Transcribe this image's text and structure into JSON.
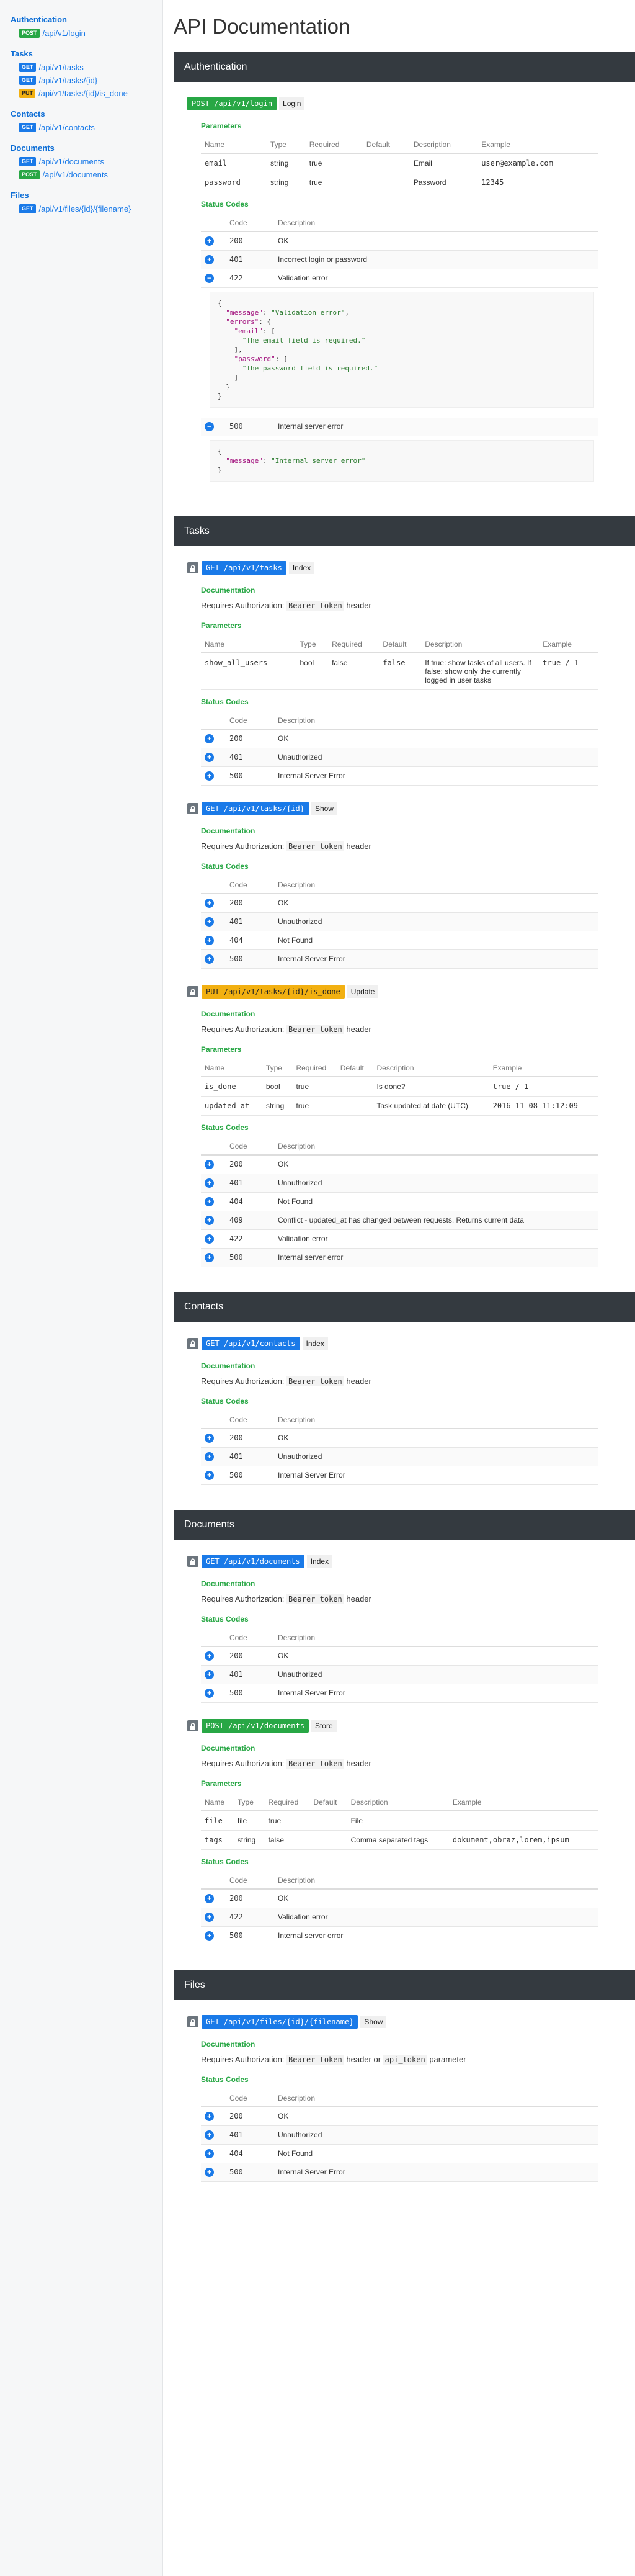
{
  "page_title": "API Documentation",
  "sidebar": [
    {
      "title": "Authentication",
      "items": [
        {
          "method": "POST",
          "path": "/api/v1/login"
        }
      ]
    },
    {
      "title": "Tasks",
      "items": [
        {
          "method": "GET",
          "path": "/api/v1/tasks"
        },
        {
          "method": "GET",
          "path": "/api/v1/tasks/{id}"
        },
        {
          "method": "PUT",
          "path": "/api/v1/tasks/{id}/is_done"
        }
      ]
    },
    {
      "title": "Contacts",
      "items": [
        {
          "method": "GET",
          "path": "/api/v1/contacts"
        }
      ]
    },
    {
      "title": "Documents",
      "items": [
        {
          "method": "GET",
          "path": "/api/v1/documents"
        },
        {
          "method": "POST",
          "path": "/api/v1/documents"
        }
      ]
    },
    {
      "title": "Files",
      "items": [
        {
          "method": "GET",
          "path": "/api/v1/files/{id}/{filename}"
        }
      ]
    }
  ],
  "labels": {
    "documentation": "Documentation",
    "parameters": "Parameters",
    "status_codes": "Status Codes",
    "requires": "Requires Authorization:",
    "bearer": "Bearer token",
    "header": "header",
    "or": "or",
    "api_token": "api_token",
    "parameter": "parameter",
    "param_cols": [
      "Name",
      "Type",
      "Required",
      "Default",
      "Description",
      "Example"
    ],
    "status_cols": [
      "Code",
      "Description"
    ]
  },
  "sections": [
    {
      "title": "Authentication",
      "endpoints": [
        {
          "method": "POST",
          "path": "/api/v1/login",
          "name": "Login",
          "locked": false,
          "auth": false,
          "params": [
            {
              "name": "email",
              "type": "string",
              "required": "true",
              "default": "",
              "description": "Email",
              "example": "user@example.com"
            },
            {
              "name": "password",
              "type": "string",
              "required": "true",
              "default": "",
              "description": "Password",
              "example": "12345"
            }
          ],
          "statuses": [
            {
              "icon": "plus",
              "code": "200",
              "description": "OK"
            },
            {
              "icon": "plus",
              "code": "401",
              "description": "Incorrect login or password"
            },
            {
              "icon": "minus",
              "code": "422",
              "description": "Validation error",
              "body": "{\n  \"message\": \"Validation error\",\n  \"errors\": {\n    \"email\": [\n      \"The email field is required.\"\n    ],\n    \"password\": [\n      \"The password field is required.\"\n    ]\n  }\n}"
            },
            {
              "icon": "minus",
              "code": "500",
              "description": "Internal server error",
              "body": "{\n  \"message\": \"Internal server error\"\n}"
            }
          ]
        }
      ]
    },
    {
      "title": "Tasks",
      "endpoints": [
        {
          "method": "GET",
          "path": "/api/v1/tasks",
          "name": "Index",
          "locked": true,
          "auth": true,
          "params": [
            {
              "name": "show_all_users",
              "type": "bool",
              "required": "false",
              "default": "false",
              "description": "If true: show tasks of all users. If false: show only the currently logged in user tasks",
              "example": "true / 1"
            }
          ],
          "statuses": [
            {
              "icon": "plus",
              "code": "200",
              "description": "OK"
            },
            {
              "icon": "plus",
              "code": "401",
              "description": "Unauthorized"
            },
            {
              "icon": "plus",
              "code": "500",
              "description": "Internal Server Error"
            }
          ]
        },
        {
          "method": "GET",
          "path": "/api/v1/tasks/{id}",
          "name": "Show",
          "locked": true,
          "auth": true,
          "params": [],
          "statuses": [
            {
              "icon": "plus",
              "code": "200",
              "description": "OK"
            },
            {
              "icon": "plus",
              "code": "401",
              "description": "Unauthorized"
            },
            {
              "icon": "plus",
              "code": "404",
              "description": "Not Found"
            },
            {
              "icon": "plus",
              "code": "500",
              "description": "Internal Server Error"
            }
          ]
        },
        {
          "method": "PUT",
          "path": "/api/v1/tasks/{id}/is_done",
          "name": "Update",
          "locked": true,
          "auth": true,
          "params": [
            {
              "name": "is_done",
              "type": "bool",
              "required": "true",
              "default": "",
              "description": "Is done?",
              "example": "true / 1"
            },
            {
              "name": "updated_at",
              "type": "string",
              "required": "true",
              "default": "",
              "description": "Task updated at date (UTC)",
              "example": "2016-11-08 11:12:09"
            }
          ],
          "statuses": [
            {
              "icon": "plus",
              "code": "200",
              "description": "OK"
            },
            {
              "icon": "plus",
              "code": "401",
              "description": "Unauthorized"
            },
            {
              "icon": "plus",
              "code": "404",
              "description": "Not Found"
            },
            {
              "icon": "plus",
              "code": "409",
              "description": "Conflict - updated_at has changed between requests. Returns current data"
            },
            {
              "icon": "plus",
              "code": "422",
              "description": "Validation error"
            },
            {
              "icon": "plus",
              "code": "500",
              "description": "Internal server error"
            }
          ]
        }
      ]
    },
    {
      "title": "Contacts",
      "endpoints": [
        {
          "method": "GET",
          "path": "/api/v1/contacts",
          "name": "Index",
          "locked": true,
          "auth": true,
          "params": [],
          "statuses": [
            {
              "icon": "plus",
              "code": "200",
              "description": "OK"
            },
            {
              "icon": "plus",
              "code": "401",
              "description": "Unauthorized"
            },
            {
              "icon": "plus",
              "code": "500",
              "description": "Internal Server Error"
            }
          ]
        }
      ]
    },
    {
      "title": "Documents",
      "endpoints": [
        {
          "method": "GET",
          "path": "/api/v1/documents",
          "name": "Index",
          "locked": true,
          "auth": true,
          "params": [],
          "statuses": [
            {
              "icon": "plus",
              "code": "200",
              "description": "OK"
            },
            {
              "icon": "plus",
              "code": "401",
              "description": "Unauthorized"
            },
            {
              "icon": "plus",
              "code": "500",
              "description": "Internal Server Error"
            }
          ]
        },
        {
          "method": "POST",
          "path": "/api/v1/documents",
          "name": "Store",
          "locked": true,
          "auth": true,
          "params": [
            {
              "name": "file",
              "type": "file",
              "required": "true",
              "default": "",
              "description": "File",
              "example": ""
            },
            {
              "name": "tags",
              "type": "string",
              "required": "false",
              "default": "",
              "description": "Comma separated tags",
              "example": "dokument,obraz,lorem,ipsum"
            }
          ],
          "statuses": [
            {
              "icon": "plus",
              "code": "200",
              "description": "OK"
            },
            {
              "icon": "plus",
              "code": "422",
              "description": "Validation error"
            },
            {
              "icon": "plus",
              "code": "500",
              "description": "Internal server error"
            }
          ]
        }
      ]
    },
    {
      "title": "Files",
      "endpoints": [
        {
          "method": "GET",
          "path": "/api/v1/files/{id}/{filename}",
          "name": "Show",
          "locked": true,
          "auth": true,
          "auth_alt": true,
          "params": [],
          "statuses": [
            {
              "icon": "plus",
              "code": "200",
              "description": "OK"
            },
            {
              "icon": "plus",
              "code": "401",
              "description": "Unauthorized"
            },
            {
              "icon": "plus",
              "code": "404",
              "description": "Not Found"
            },
            {
              "icon": "plus",
              "code": "500",
              "description": "Internal Server Error"
            }
          ]
        }
      ]
    }
  ]
}
